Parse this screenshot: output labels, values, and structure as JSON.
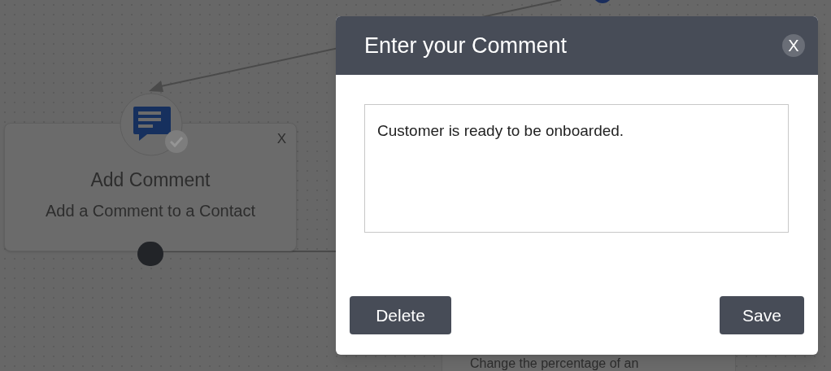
{
  "canvas": {
    "nodes": [
      {
        "kind": "action",
        "title": "Add Comment",
        "description": "Add a Comment to a Contact",
        "close": "X",
        "completed": true
      },
      {
        "kind": "partial",
        "description": "Change the percentage of an"
      }
    ]
  },
  "dialog": {
    "title": "Enter your Comment",
    "close": "X",
    "comment": {
      "value": "Customer is ready to be onboarded."
    },
    "buttons": [
      {
        "kind": "delete",
        "label": "Delete"
      },
      {
        "kind": "save",
        "label": "Save"
      }
    ]
  }
}
